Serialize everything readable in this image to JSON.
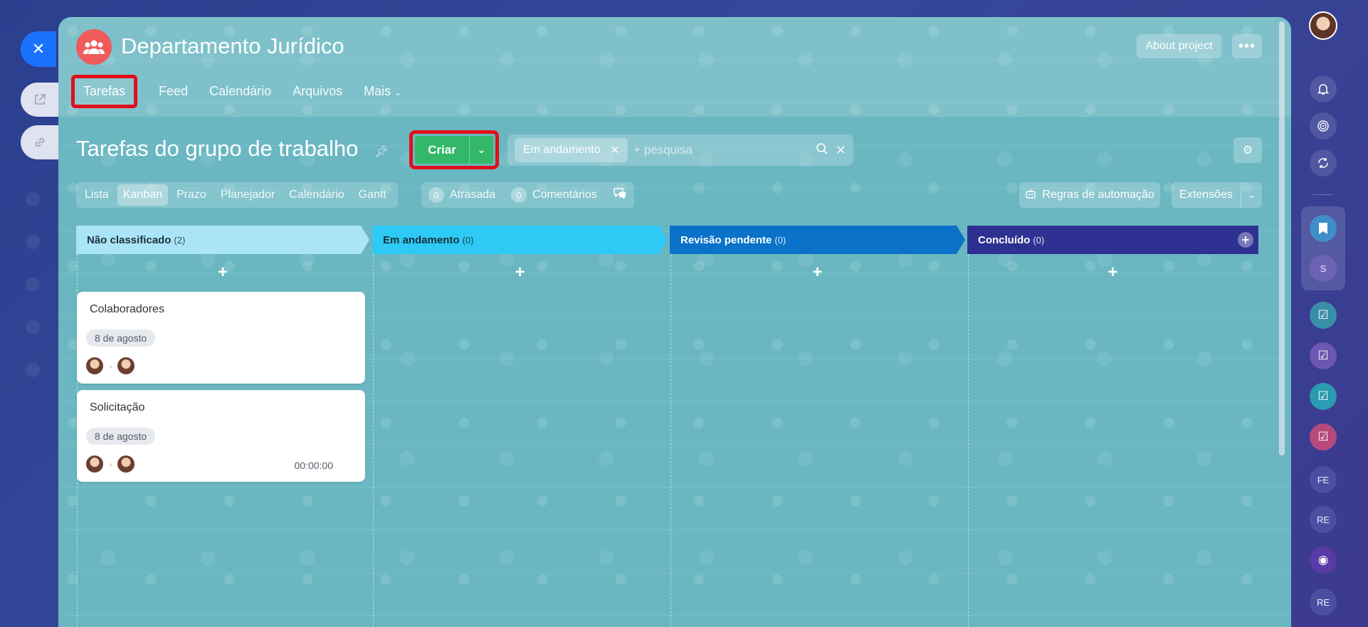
{
  "project": {
    "title": "Departamento Jurídico",
    "about_label": "About project",
    "more_label": "•••"
  },
  "nav": {
    "items": [
      {
        "label": "Tarefas",
        "active": true
      },
      {
        "label": "Feed"
      },
      {
        "label": "Calendário"
      },
      {
        "label": "Arquivos"
      },
      {
        "label": "Mais"
      }
    ]
  },
  "toolbar": {
    "title": "Tarefas do grupo de trabalho",
    "create_label": "Criar",
    "filter_chip": "Em andamento",
    "search_placeholder": "+ pesquisa"
  },
  "views": {
    "tabs": [
      "Lista",
      "Kanban",
      "Prazo",
      "Planejador",
      "Calendário",
      "Gantt"
    ],
    "active": "Kanban"
  },
  "counters": {
    "overdue": {
      "count": "0",
      "label": "Atrasada"
    },
    "comments": {
      "count": "0",
      "label": "Comentários"
    }
  },
  "actions": {
    "automation_label": "Regras de automação",
    "extensions_label": "Extensões"
  },
  "columns": [
    {
      "title": "Não classificado",
      "count": "(2)",
      "color": "#a9e5f7",
      "text_color": "#1f2f3a"
    },
    {
      "title": "Em andamento",
      "count": "(0)",
      "color": "#2fc9f5",
      "text_color": "#17303b"
    },
    {
      "title": "Revisão pendente",
      "count": "(0)",
      "color": "#0a72c8",
      "text_color": "#ffffff"
    },
    {
      "title": "Concluído",
      "count": "(0)",
      "color": "#2e3191",
      "text_color": "#ffffff"
    }
  ],
  "cards": [
    {
      "title": "Colaboradores",
      "date": "8 de agosto",
      "timer": ""
    },
    {
      "title": "Solicitação",
      "date": "8 de agosto",
      "timer": "00:00:00"
    }
  ],
  "right_rail": {
    "badges": [
      "S",
      "FE",
      "RE",
      "RE"
    ]
  },
  "colors": {
    "accent_green": "#33b86a",
    "highlight_red": "#e0101a",
    "close_blue": "#1a73ff",
    "project_avatar": "#ef5b5b"
  }
}
